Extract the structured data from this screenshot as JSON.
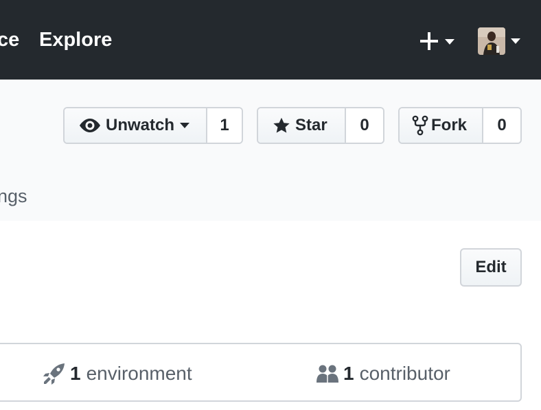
{
  "header": {
    "nav_partial": "ce",
    "nav_explore": "Explore"
  },
  "repo_actions": {
    "watch": {
      "label": "Unwatch",
      "count": "1"
    },
    "star": {
      "label": "Star",
      "count": "0"
    },
    "fork": {
      "label": "Fork",
      "count": "0"
    }
  },
  "tabs": {
    "partial_settings": "ngs"
  },
  "about": {
    "edit_label": "Edit"
  },
  "summary": {
    "environments": {
      "count": "1",
      "label": "environment"
    },
    "contributors": {
      "count": "1",
      "label": "contributor"
    }
  },
  "icons": {
    "plus": "plus-icon",
    "avatar": "user-avatar",
    "eye": "eye-icon",
    "star": "star-icon",
    "fork": "repo-forked-icon",
    "rocket": "rocket-icon",
    "people": "people-icon"
  },
  "colors": {
    "header_bg": "#24292e",
    "subheader_bg": "#f9fafb",
    "border": "#d1d5da",
    "text_primary": "#24292e",
    "text_muted": "#586069"
  }
}
